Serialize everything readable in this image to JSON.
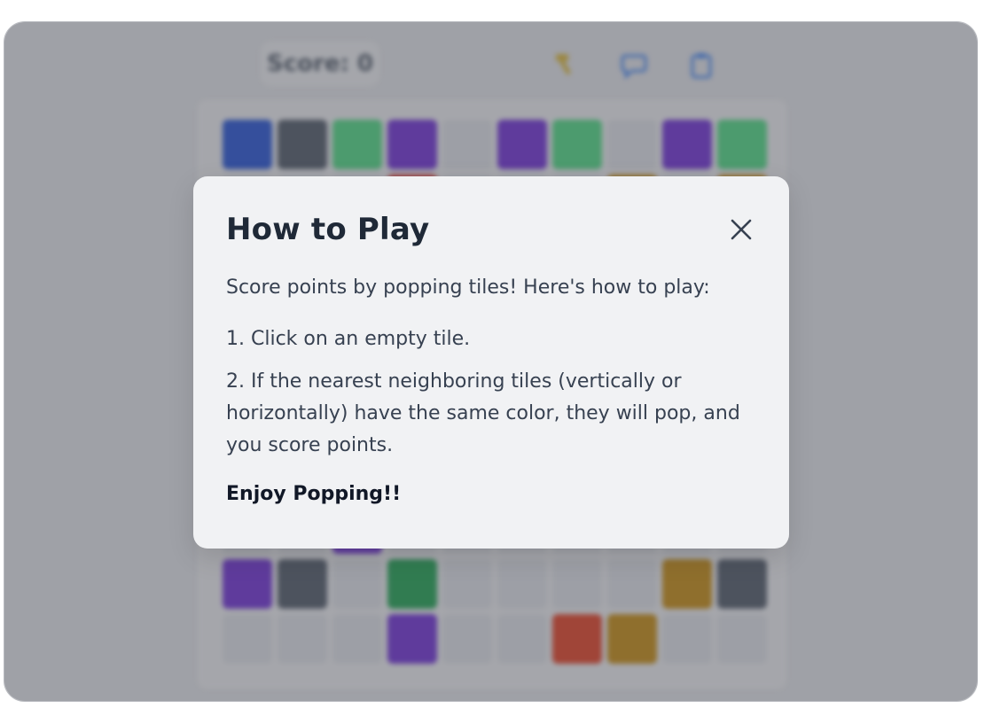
{
  "header": {
    "score_label": "Score: 0",
    "tools": [
      {
        "icon": "hammer-icon",
        "color": "#e0b82c"
      },
      {
        "icon": "chat-icon",
        "color": "#3b82f6"
      },
      {
        "icon": "clipboard-icon",
        "color": "#3b82f6"
      }
    ]
  },
  "board": {
    "tiles": [
      {
        "row": 0,
        "col": 0,
        "color": "#1d4ed8"
      },
      {
        "row": 0,
        "col": 1,
        "color": "#4b5563"
      },
      {
        "row": 0,
        "col": 2,
        "color": "#4ade80"
      },
      {
        "row": 0,
        "col": 3,
        "color": "#6d28d9"
      },
      {
        "row": 0,
        "col": 5,
        "color": "#6d28d9"
      },
      {
        "row": 0,
        "col": 6,
        "color": "#4ade80"
      },
      {
        "row": 0,
        "col": 8,
        "color": "#6d28d9"
      },
      {
        "row": 0,
        "col": 9,
        "color": "#4ade80"
      },
      {
        "row": 1,
        "col": 3,
        "color": "#dc2626"
      },
      {
        "row": 1,
        "col": 7,
        "color": "#ca8a04"
      },
      {
        "row": 1,
        "col": 9,
        "color": "#ca8a04"
      },
      {
        "row": 7,
        "col": 2,
        "color": "#6d28d9"
      },
      {
        "row": 8,
        "col": 0,
        "color": "#6d28d9"
      },
      {
        "row": 8,
        "col": 1,
        "color": "#4b5563"
      },
      {
        "row": 8,
        "col": 3,
        "color": "#16a34a"
      },
      {
        "row": 8,
        "col": 8,
        "color": "#ca8a04"
      },
      {
        "row": 8,
        "col": 9,
        "color": "#4b5563"
      },
      {
        "row": 9,
        "col": 3,
        "color": "#6d28d9"
      },
      {
        "row": 9,
        "col": 6,
        "color": "#ea3a1a"
      },
      {
        "row": 9,
        "col": 7,
        "color": "#ca8a04"
      }
    ]
  },
  "modal": {
    "title": "How to Play",
    "close_icon": "close-icon",
    "intro": "Score points by popping tiles! Here's how to play:",
    "step1": "1. Click on an empty tile.",
    "step2": "2. If the nearest neighboring tiles (vertically or horizontally) have the same color, they will pop, and you score points.",
    "outro": "Enjoy Popping!!"
  }
}
